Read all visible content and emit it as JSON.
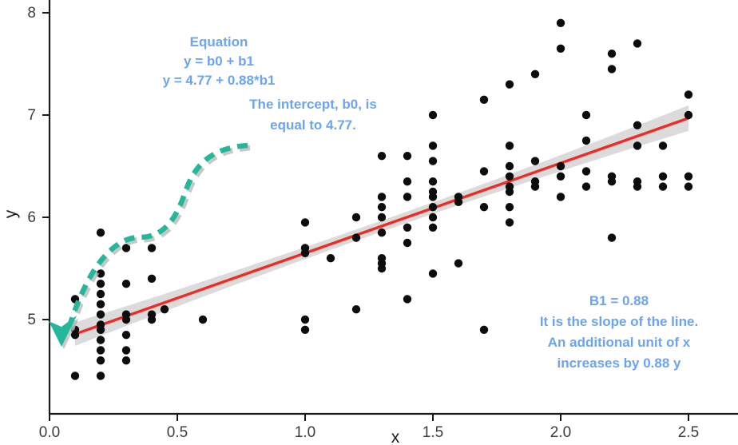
{
  "chart_data": {
    "type": "scatter",
    "title": "",
    "xlabel": "x",
    "ylabel": "y",
    "xlim": [
      0.0,
      2.6
    ],
    "ylim": [
      4.35,
      8.05
    ],
    "xticks": [
      "0.0",
      "0.5",
      "1.0",
      "1.5",
      "2.0",
      "2.5"
    ],
    "xtick_values": [
      0.0,
      0.5,
      1.0,
      1.5,
      2.0,
      2.5
    ],
    "yticks": [
      "5",
      "6",
      "7",
      "8"
    ],
    "ytick_values": [
      5,
      6,
      7,
      8
    ],
    "grid": false,
    "legend": "none",
    "point_color": "#0d0d0d",
    "fit_line_color": "#ef2b24",
    "ci_band_color": "#d9d9d9",
    "annotation_color": "#6ba4f0",
    "arrow_color": "#25b79b",
    "regression": {
      "intercept": 4.77,
      "slope": 0.88,
      "x_start": 0.1,
      "x_end": 2.5,
      "ci_half_width_start": 0.115,
      "ci_half_width_mid": 0.055,
      "ci_half_width_end": 0.125
    },
    "points": [
      [
        0.1,
        5.2
      ],
      [
        0.1,
        4.9
      ],
      [
        0.1,
        4.85
      ],
      [
        0.1,
        4.45
      ],
      [
        0.2,
        5.85
      ],
      [
        0.2,
        5.45
      ],
      [
        0.2,
        5.35
      ],
      [
        0.2,
        5.25
      ],
      [
        0.2,
        5.15
      ],
      [
        0.2,
        5.05
      ],
      [
        0.2,
        4.95
      ],
      [
        0.2,
        4.9
      ],
      [
        0.2,
        4.8
      ],
      [
        0.2,
        4.7
      ],
      [
        0.2,
        4.6
      ],
      [
        0.2,
        4.45
      ],
      [
        0.3,
        5.7
      ],
      [
        0.3,
        5.35
      ],
      [
        0.3,
        5.05
      ],
      [
        0.3,
        5.0
      ],
      [
        0.3,
        4.85
      ],
      [
        0.3,
        4.7
      ],
      [
        0.3,
        4.6
      ],
      [
        0.4,
        5.7
      ],
      [
        0.4,
        5.4
      ],
      [
        0.4,
        5.05
      ],
      [
        0.4,
        5.0
      ],
      [
        0.45,
        5.1
      ],
      [
        0.6,
        5.0
      ],
      [
        1.0,
        5.95
      ],
      [
        1.0,
        5.7
      ],
      [
        1.0,
        5.65
      ],
      [
        1.0,
        5.0
      ],
      [
        1.0,
        4.9
      ],
      [
        1.1,
        5.6
      ],
      [
        1.2,
        6.0
      ],
      [
        1.2,
        5.8
      ],
      [
        1.2,
        5.1
      ],
      [
        1.3,
        6.6
      ],
      [
        1.3,
        6.2
      ],
      [
        1.3,
        6.1
      ],
      [
        1.3,
        6.0
      ],
      [
        1.3,
        5.85
      ],
      [
        1.3,
        5.6
      ],
      [
        1.3,
        5.55
      ],
      [
        1.3,
        5.5
      ],
      [
        1.4,
        6.6
      ],
      [
        1.4,
        6.35
      ],
      [
        1.4,
        6.2
      ],
      [
        1.4,
        5.9
      ],
      [
        1.4,
        5.75
      ],
      [
        1.4,
        5.2
      ],
      [
        1.5,
        7.0
      ],
      [
        1.5,
        6.7
      ],
      [
        1.5,
        6.55
      ],
      [
        1.5,
        6.35
      ],
      [
        1.5,
        6.25
      ],
      [
        1.5,
        6.2
      ],
      [
        1.5,
        6.1
      ],
      [
        1.5,
        6.0
      ],
      [
        1.5,
        5.9
      ],
      [
        1.5,
        5.45
      ],
      [
        1.6,
        6.2
      ],
      [
        1.6,
        6.15
      ],
      [
        1.6,
        5.55
      ],
      [
        1.7,
        7.15
      ],
      [
        1.7,
        6.45
      ],
      [
        1.7,
        6.1
      ],
      [
        1.7,
        4.9
      ],
      [
        1.8,
        7.3
      ],
      [
        1.8,
        6.7
      ],
      [
        1.8,
        6.5
      ],
      [
        1.8,
        6.4
      ],
      [
        1.8,
        6.3
      ],
      [
        1.8,
        6.25
      ],
      [
        1.8,
        6.1
      ],
      [
        1.8,
        5.95
      ],
      [
        1.9,
        7.4
      ],
      [
        1.9,
        6.55
      ],
      [
        1.9,
        6.35
      ],
      [
        1.9,
        6.3
      ],
      [
        2.0,
        7.9
      ],
      [
        2.0,
        7.65
      ],
      [
        2.0,
        6.5
      ],
      [
        2.0,
        6.4
      ],
      [
        2.0,
        6.2
      ],
      [
        2.1,
        7.0
      ],
      [
        2.1,
        6.75
      ],
      [
        2.1,
        6.45
      ],
      [
        2.1,
        6.3
      ],
      [
        2.2,
        7.6
      ],
      [
        2.2,
        7.45
      ],
      [
        2.2,
        6.4
      ],
      [
        2.2,
        6.35
      ],
      [
        2.2,
        5.8
      ],
      [
        2.3,
        7.7
      ],
      [
        2.3,
        6.9
      ],
      [
        2.3,
        6.7
      ],
      [
        2.3,
        6.35
      ],
      [
        2.3,
        6.3
      ],
      [
        2.4,
        6.7
      ],
      [
        2.4,
        6.4
      ],
      [
        2.4,
        6.3
      ],
      [
        2.5,
        7.2
      ],
      [
        2.5,
        7.0
      ],
      [
        2.5,
        6.4
      ],
      [
        2.5,
        6.3
      ]
    ]
  },
  "annotations": {
    "equation": {
      "title": "Equation",
      "line1": "y = b0 + b1",
      "line2": "y = 4.77 + 0.88*b1"
    },
    "intercept_note": {
      "line1": "The intercept, b0, is",
      "line2": "equal to 4.77."
    },
    "slope_note": {
      "line1": "B1 = 0.88",
      "line2": "It is the slope of the line.",
      "line3": "An additional unit of x",
      "line4": "increases by 0.88 y"
    }
  }
}
